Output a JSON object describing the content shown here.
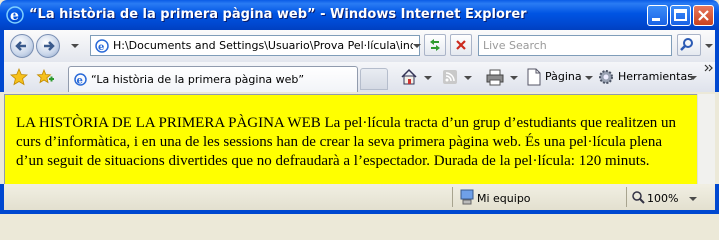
{
  "window": {
    "title": "“La història de la primera pàgina web” - Windows Internet Explorer"
  },
  "navigation": {
    "address": "H:\\Documents and Settings\\Usuario\\Prova Pel·lícula\\index.h",
    "search_placeholder": "Live Search"
  },
  "tabs": [
    {
      "label": "“La història de la primera pàgina web”"
    }
  ],
  "command_bar": {
    "page_label": "Pàgina",
    "tools_label": "Herramientas"
  },
  "content": {
    "text": "LA HISTÒRIA DE LA PRIMERA PÀGINA WEB La pel·lícula tracta d’un grup d’estudiants que realitzen un curs d’informàtica, i en una de les sessions han de crear la seva primera pàgina web. És una pel·lícula plena d’un seguit de situacions divertides que no defraudarà a l’espectador. Durada de la pel·lícula: 120 minuts.",
    "background_color": "#ffff00"
  },
  "status_bar": {
    "zone": "Mi equipo",
    "zoom": "100%"
  }
}
